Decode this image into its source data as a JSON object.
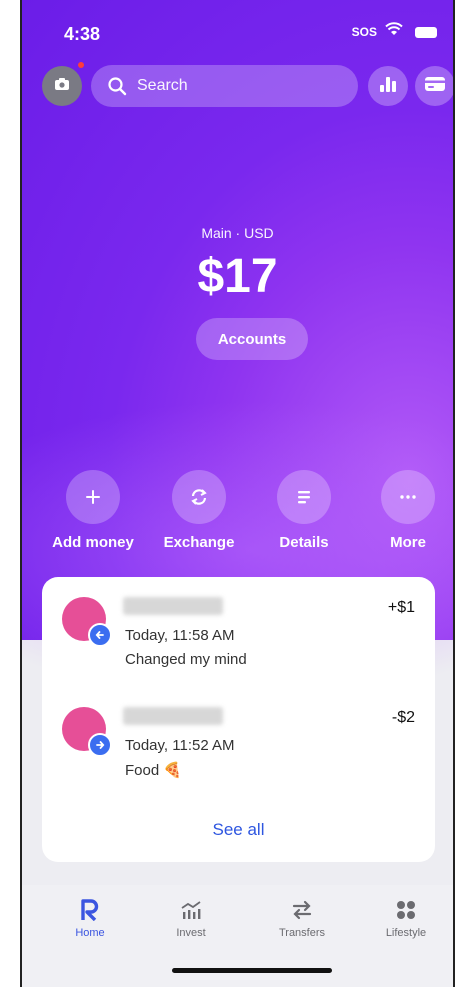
{
  "status": {
    "time": "4:38",
    "sos": "SOS"
  },
  "search": {
    "label": "Search"
  },
  "balance": {
    "account": "Main · USD",
    "amount": "$17"
  },
  "accounts_button": "Accounts",
  "actions": [
    {
      "label": "Add money",
      "icon": "plus-icon"
    },
    {
      "label": "Exchange",
      "icon": "exchange-icon"
    },
    {
      "label": "Details",
      "icon": "details-icon"
    },
    {
      "label": "More",
      "icon": "more-icon"
    }
  ],
  "transactions": [
    {
      "amount": "+$1",
      "time": "Today, 11:58 AM",
      "note": "Changed my mind",
      "direction": "incoming"
    },
    {
      "amount": "-$2",
      "time": "Today, 11:52 AM",
      "note": "Food 🍕",
      "direction": "outgoing"
    }
  ],
  "see_all": "See all",
  "tabs": [
    {
      "label": "Home",
      "icon": "home-r-icon",
      "active": true
    },
    {
      "label": "Invest",
      "icon": "invest-icon",
      "active": false
    },
    {
      "label": "Transfers",
      "icon": "transfers-icon",
      "active": false
    },
    {
      "label": "Lifestyle",
      "icon": "lifestyle-icon",
      "active": false
    }
  ],
  "colors": {
    "hero_primary": "#7a28ee",
    "accent_blue": "#2e56e0",
    "avatar_pink": "#e64f97"
  }
}
